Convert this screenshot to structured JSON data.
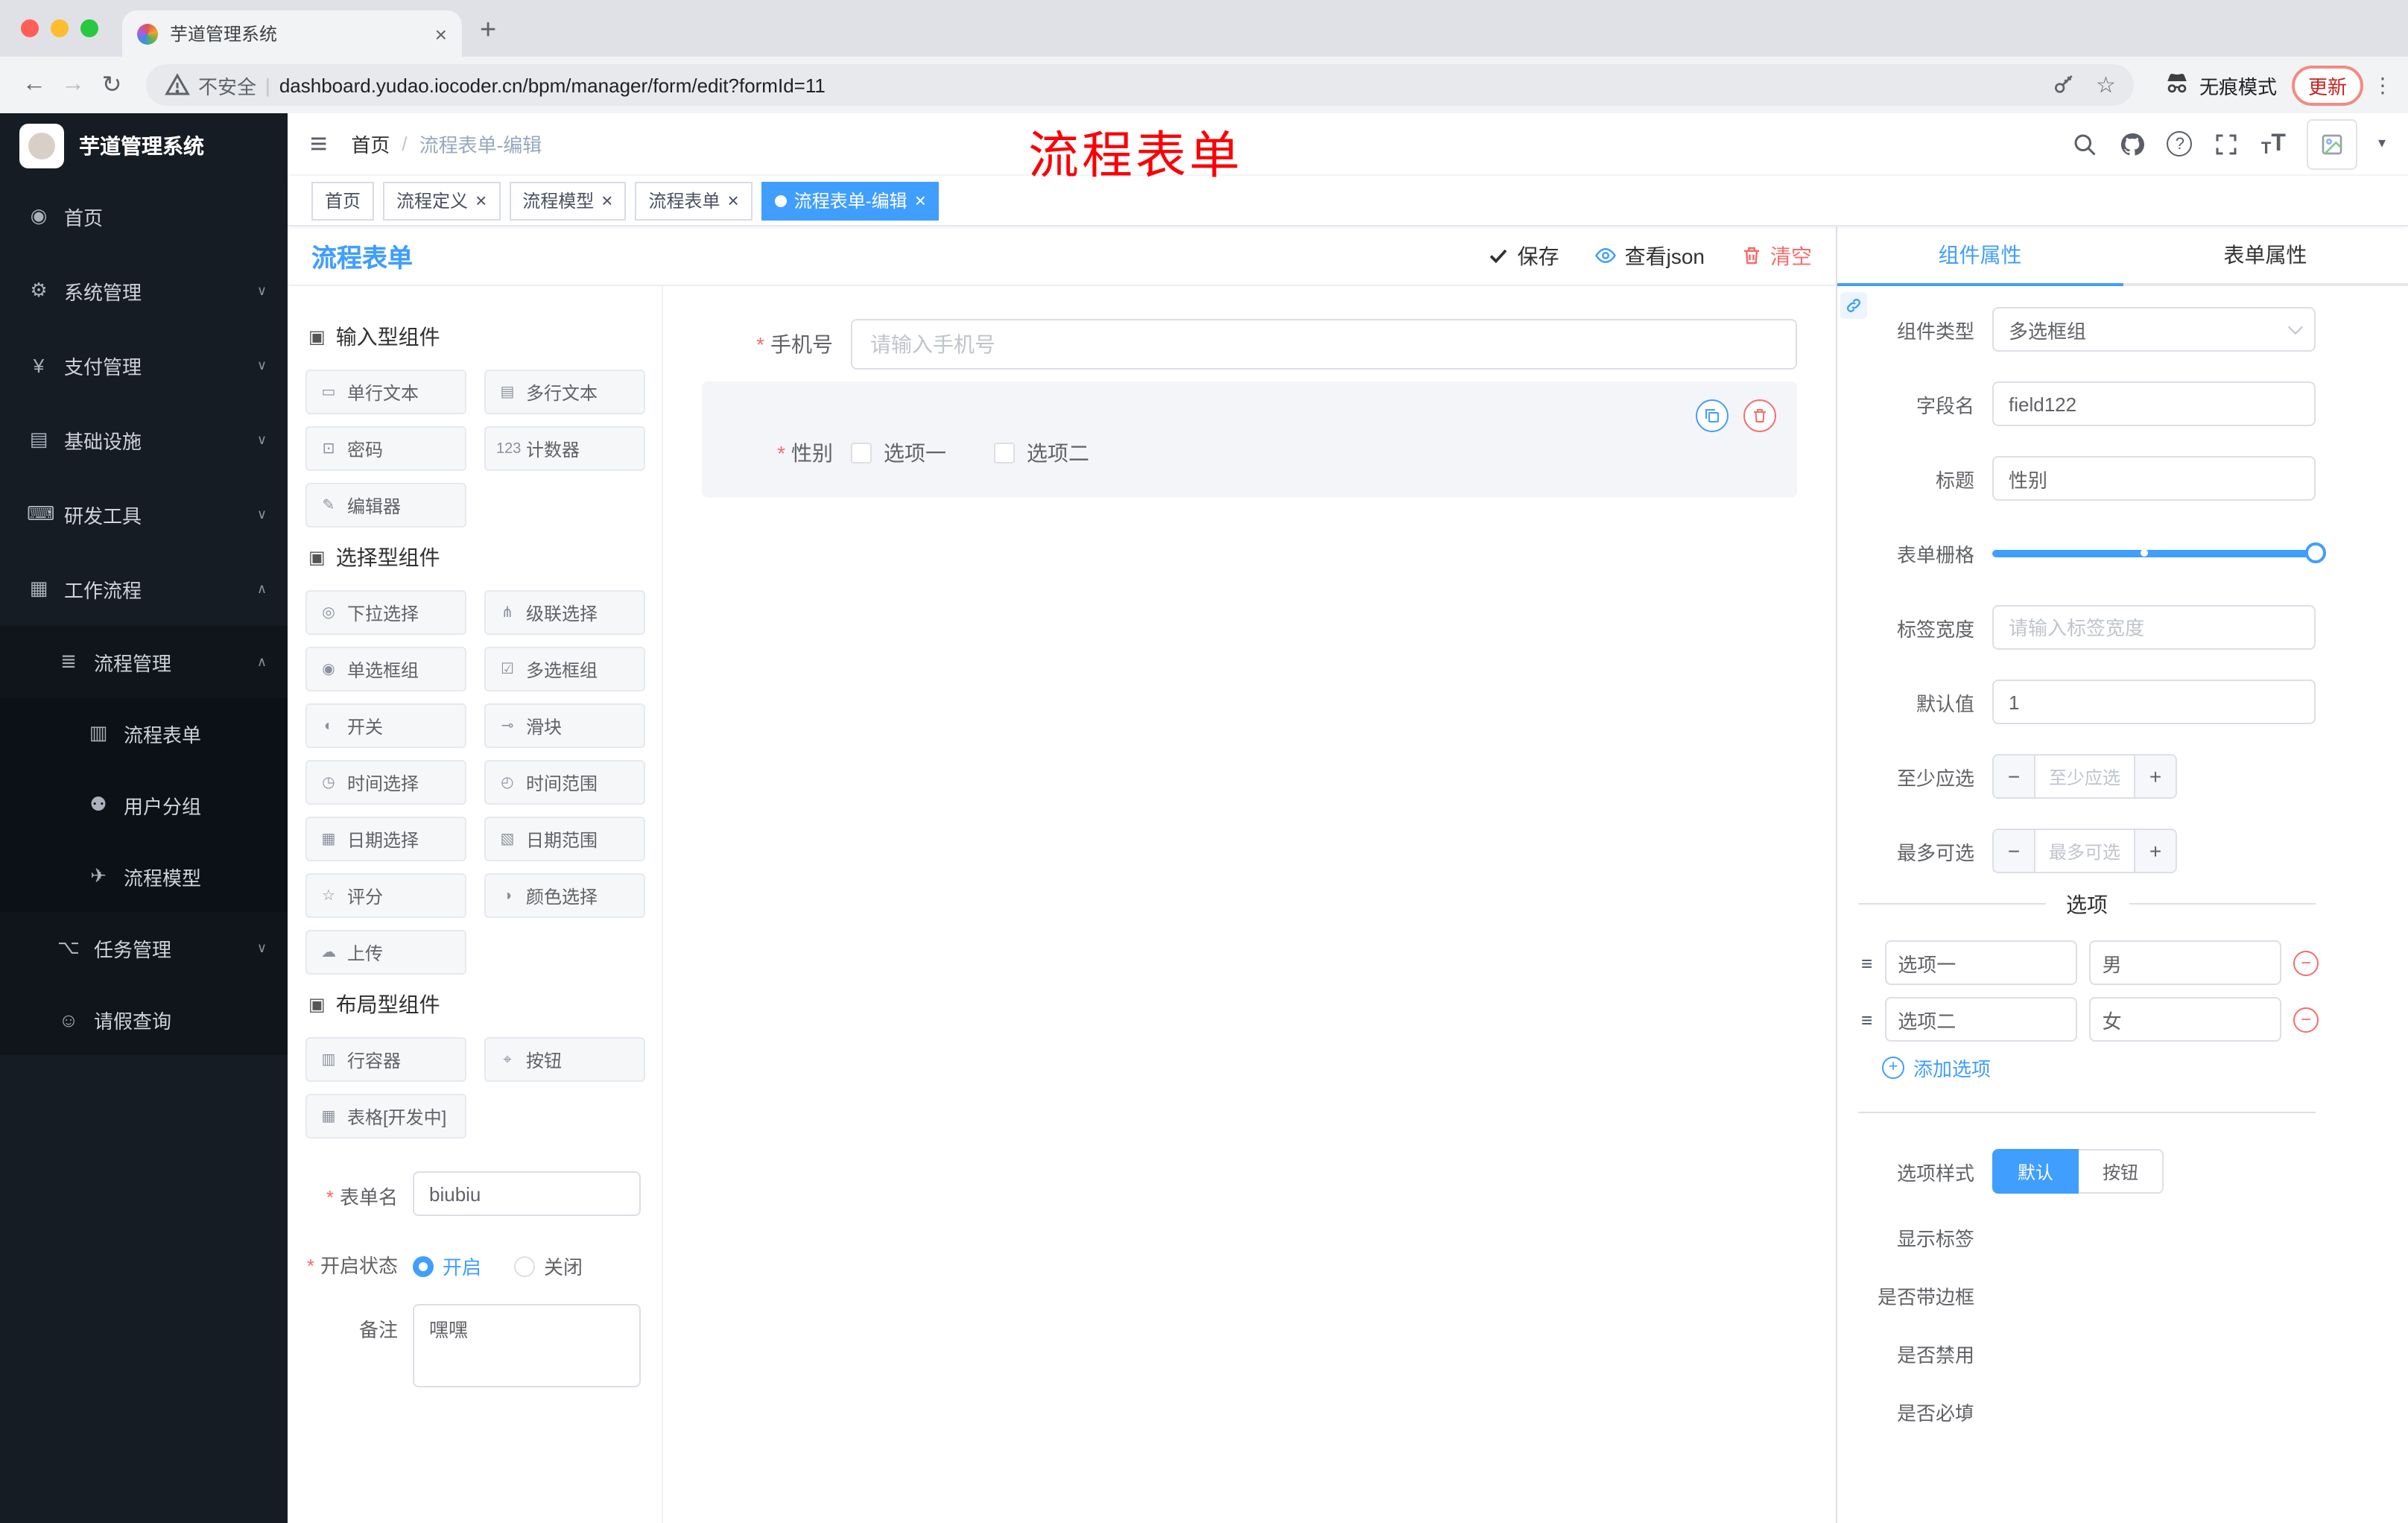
{
  "browser": {
    "tab_title": "芋道管理系统",
    "security_text": "不安全",
    "url": "dashboard.yudao.iocoder.cn/bpm/manager/form/edit?formId=11",
    "incognito_label": "无痕模式",
    "update_label": "更新"
  },
  "glyphs": {
    "back": "←",
    "forward": "→",
    "reload": "↻",
    "kebab": "⋮",
    "star": "☆",
    "newtab": "+",
    "close": "×",
    "minus": "−",
    "plus": "+",
    "caret_down": "▾",
    "hamburger": "≡",
    "question": "?",
    "slash": "/",
    "drag": "≡",
    "dot": "●",
    "size_small": "T",
    "size_big": "T",
    "group_cube": "▣"
  },
  "sidebar": {
    "logo": "芋道管理系统",
    "top_items": [
      {
        "icon": "dashboard-icon",
        "glyph": "◉",
        "label": "首页",
        "arrow": ""
      },
      {
        "icon": "gear-icon",
        "glyph": "⚙",
        "label": "系统管理",
        "arrow": "∨"
      },
      {
        "icon": "payment-icon",
        "glyph": "¥",
        "label": "支付管理",
        "arrow": "∨"
      },
      {
        "icon": "infrastructure-icon",
        "glyph": "▤",
        "label": "基础设施",
        "arrow": "∨"
      },
      {
        "icon": "devtools-icon",
        "glyph": "⌨",
        "label": "研发工具",
        "arrow": "∨"
      },
      {
        "icon": "workflow-icon",
        "glyph": "▦",
        "label": "工作流程",
        "arrow": "∧"
      }
    ],
    "process_mgmt": {
      "glyph": "≣",
      "label": "流程管理",
      "arrow": "∧"
    },
    "process_children": [
      {
        "icon": "process-form-icon",
        "glyph": "▥",
        "label": "流程表单"
      },
      {
        "icon": "user-group-icon",
        "glyph": "⚉",
        "label": "用户分组"
      },
      {
        "icon": "process-model-icon",
        "glyph": "✈",
        "label": "流程模型"
      }
    ],
    "task_mgmt": {
      "glyph": "⌥",
      "label": "任务管理",
      "arrow": "∨"
    },
    "leave_query": {
      "glyph": "☺",
      "label": "请假查询"
    }
  },
  "header": {
    "breadcrumb_home": "首页",
    "breadcrumb_current": "流程表单-编辑",
    "annotation": "流程表单"
  },
  "tags": {
    "items": [
      {
        "label": "首页"
      },
      {
        "label": "流程定义"
      },
      {
        "label": "流程模型"
      },
      {
        "label": "流程表单"
      },
      {
        "label": "流程表单-编辑"
      }
    ]
  },
  "designer": {
    "title": "流程表单",
    "actions": {
      "save": "保存",
      "view_json": "查看json",
      "clear": "清空"
    },
    "groups": [
      {
        "title": "输入型组件",
        "items": [
          {
            "icon": "single-line-text-icon",
            "glyph": "▭",
            "label": "单行文本"
          },
          {
            "icon": "multi-line-text-icon",
            "glyph": "▤",
            "label": "多行文本"
          },
          {
            "icon": "password-icon",
            "glyph": "⊡",
            "label": "密码"
          },
          {
            "icon": "counter-icon",
            "glyph": "123",
            "label": "计数器"
          },
          {
            "icon": "editor-icon",
            "glyph": "✎",
            "label": "编辑器"
          }
        ]
      },
      {
        "title": "选择型组件",
        "items": [
          {
            "icon": "select-icon",
            "glyph": "◎",
            "label": "下拉选择"
          },
          {
            "icon": "cascader-icon",
            "glyph": "⋔",
            "label": "级联选择"
          },
          {
            "icon": "radio-group-icon",
            "glyph": "◉",
            "label": "单选框组"
          },
          {
            "icon": "checkbox-group-icon",
            "glyph": "☑",
            "label": "多选框组"
          },
          {
            "icon": "switch-icon",
            "glyph": "◐",
            "label": "开关"
          },
          {
            "icon": "slider-icon",
            "glyph": "⊸",
            "label": "滑块"
          },
          {
            "icon": "time-picker-icon",
            "glyph": "◷",
            "label": "时间选择"
          },
          {
            "icon": "time-range-icon",
            "glyph": "◴",
            "label": "时间范围"
          },
          {
            "icon": "date-picker-icon",
            "glyph": "▦",
            "label": "日期选择"
          },
          {
            "icon": "date-range-icon",
            "glyph": "▧",
            "label": "日期范围"
          },
          {
            "icon": "rate-icon",
            "glyph": "☆",
            "label": "评分"
          },
          {
            "icon": "color-picker-icon",
            "glyph": "◑",
            "label": "颜色选择"
          },
          {
            "icon": "upload-icon",
            "glyph": "☁",
            "label": "上传"
          }
        ]
      },
      {
        "title": "布局型组件",
        "items": [
          {
            "icon": "row-container-icon",
            "glyph": "▥",
            "label": "行容器"
          },
          {
            "icon": "button-icon",
            "glyph": "⌖",
            "label": "按钮"
          },
          {
            "icon": "table-icon",
            "glyph": "▦",
            "label": "表格[开发中]"
          }
        ]
      }
    ],
    "meta": {
      "name_label": "表单名",
      "name_value": "biubiu",
      "status_label": "开启状态",
      "status_on": "开启",
      "status_off": "关闭",
      "remark_label": "备注",
      "remark_value": "嘿嘿"
    },
    "canvas": {
      "phone_label": "手机号",
      "phone_placeholder": "请输入手机号",
      "gender_label": "性别",
      "gender_options": [
        "选项一",
        "选项二"
      ]
    }
  },
  "props": {
    "tabs": [
      "组件属性",
      "表单属性"
    ],
    "rows": {
      "type_label": "组件类型",
      "type_value": "多选框组",
      "field_label": "字段名",
      "field_value": "field122",
      "title_label": "标题",
      "title_value": "性别",
      "grid_label": "表单栅格",
      "width_label": "标签宽度",
      "width_placeholder": "请输入标签宽度",
      "default_label": "默认值",
      "default_value": "1",
      "min_label": "至少应选",
      "min_placeholder": "至少应选",
      "max_label": "最多可选",
      "max_placeholder": "最多可选"
    },
    "options": {
      "divider": "选项",
      "rows": [
        {
          "label": "选项一",
          "value": "男"
        },
        {
          "label": "选项二",
          "value": "女"
        }
      ],
      "add": "添加选项"
    },
    "style": {
      "label": "选项样式",
      "default_btn": "默认",
      "button_btn": "按钮"
    },
    "switches": [
      {
        "label": "显示标签",
        "on": true
      },
      {
        "label": "是否带边框",
        "on": false
      },
      {
        "label": "是否禁用",
        "on": false
      },
      {
        "label": "是否必填",
        "on": true
      }
    ]
  },
  "colors": {
    "accent": "#409eff",
    "danger": "#f56c6c",
    "annotation_red": "#fb0006",
    "sidebar_bg": "#161c24"
  }
}
